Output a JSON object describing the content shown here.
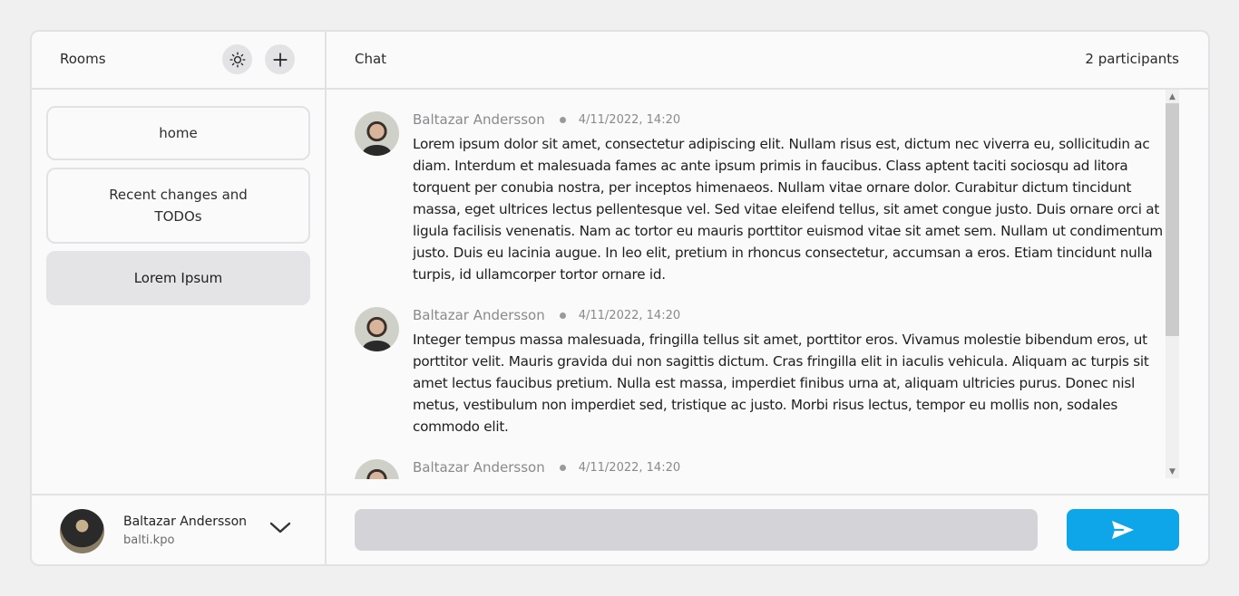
{
  "sidebar": {
    "title": "Rooms",
    "rooms": [
      {
        "label": "home"
      },
      {
        "label": "Recent changes and TODOs"
      },
      {
        "label": "Lorem Ipsum"
      }
    ]
  },
  "user": {
    "name": "Baltazar Andersson",
    "handle": "balti.kpo"
  },
  "chat": {
    "title": "Chat",
    "participants": "2 participants",
    "messages": [
      {
        "author": "Baltazar Andersson",
        "time": "4/11/2022, 14:20",
        "text": "Lorem ipsum dolor sit amet, consectetur adipiscing elit. Nullam risus est, dictum nec viverra eu, sollicitudin ac diam. Interdum et malesuada fames ac ante ipsum primis in faucibus. Class aptent taciti sociosqu ad litora torquent per conubia nostra, per inceptos himenaeos. Nullam vitae ornare dolor. Curabitur dictum tincidunt massa, eget ultrices lectus pellentesque vel. Sed vitae eleifend tellus, sit amet congue justo. Duis ornare orci at ligula facilisis venenatis. Nam ac tortor eu mauris porttitor euismod vitae sit amet sem. Nullam ut condimentum justo. Duis eu lacinia augue. In leo elit, pretium in rhoncus consectetur, accumsan a eros. Etiam tincidunt nulla turpis, id ullamcorper tortor ornare id."
      },
      {
        "author": "Baltazar Andersson",
        "time": "4/11/2022, 14:20",
        "text": "Integer tempus massa malesuada, fringilla tellus sit amet, porttitor eros. Vivamus molestie bibendum eros, ut porttitor velit. Mauris gravida dui non sagittis dictum. Cras fringilla elit in iaculis vehicula. Aliquam ac turpis sit amet lectus faucibus pretium. Nulla est massa, imperdiet finibus urna at, aliquam ultricies purus. Donec nisl metus, vestibulum non imperdiet sed, tristique ac justo. Morbi risus lectus, tempor eu mollis non, sodales commodo elit."
      },
      {
        "author": "Baltazar Andersson",
        "time": "4/11/2022, 14:20",
        "text": ""
      }
    ]
  },
  "composer": {
    "value": "",
    "placeholder": ""
  },
  "icons": {
    "theme": "sun-icon",
    "add": "plus-icon",
    "user_menu": "chevron-down-icon",
    "send": "send-icon"
  },
  "colors": {
    "accent": "#0ea5e9",
    "active_room_bg": "#e4e4e7",
    "input_bg": "#d4d4d8"
  }
}
